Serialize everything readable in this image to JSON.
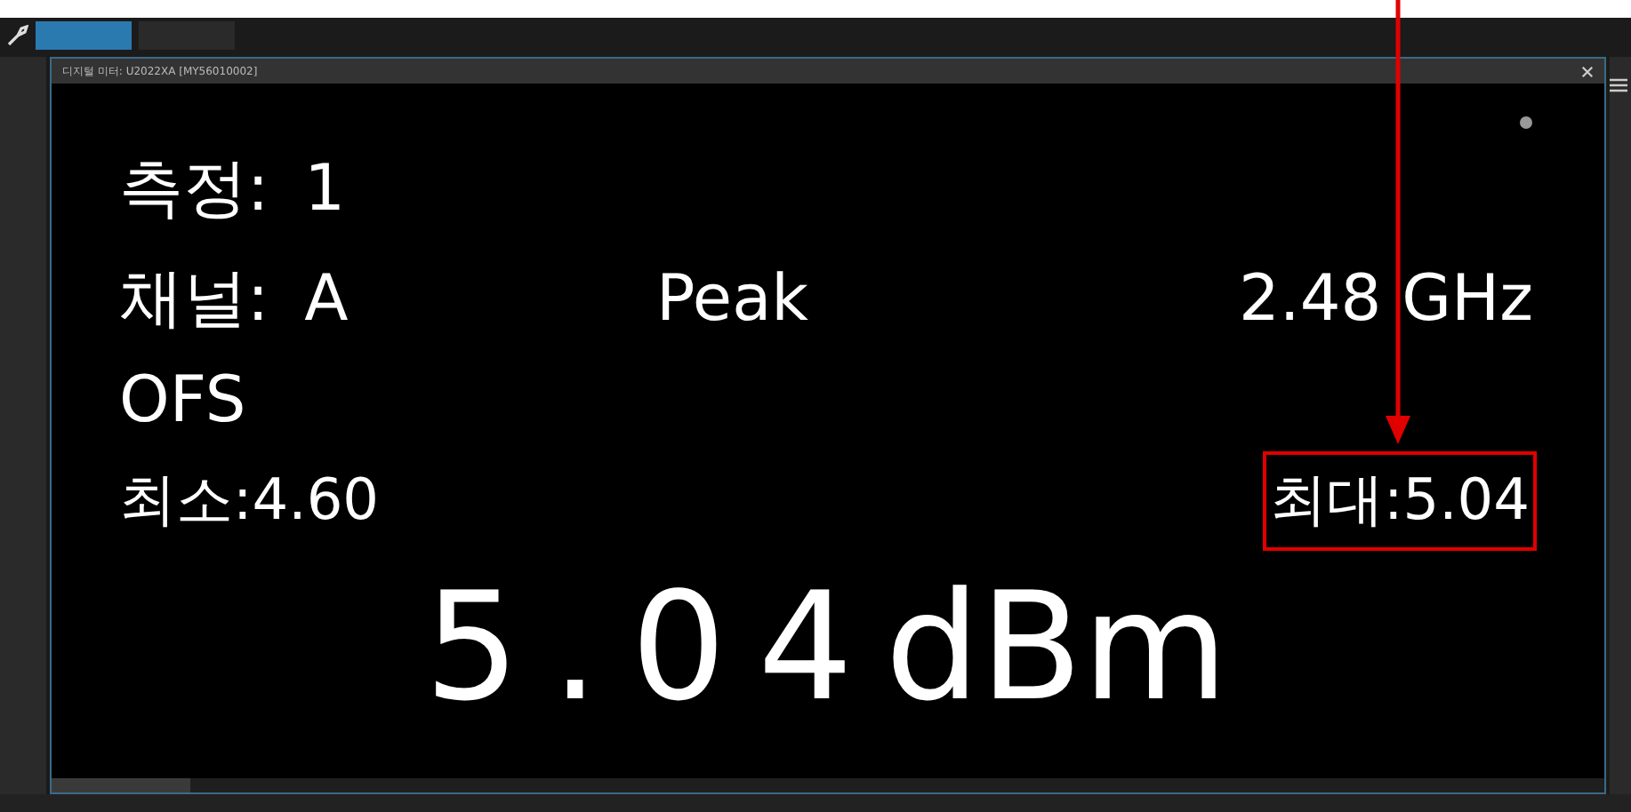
{
  "panel": {
    "title": "디지털 미터: U2022XA [MY56010002]"
  },
  "measurement": {
    "label": "측정:",
    "value": "1"
  },
  "channel": {
    "label": "채널:",
    "value": "A",
    "mode": "Peak",
    "frequency": "2.48 GHz"
  },
  "offset": "OFS",
  "min": {
    "label": "최소:",
    "value": "4.60"
  },
  "max": {
    "label": "최대:",
    "value": "5.04",
    "highlighted": true
  },
  "reading": {
    "value": "5.04",
    "unit": "dBm"
  }
}
